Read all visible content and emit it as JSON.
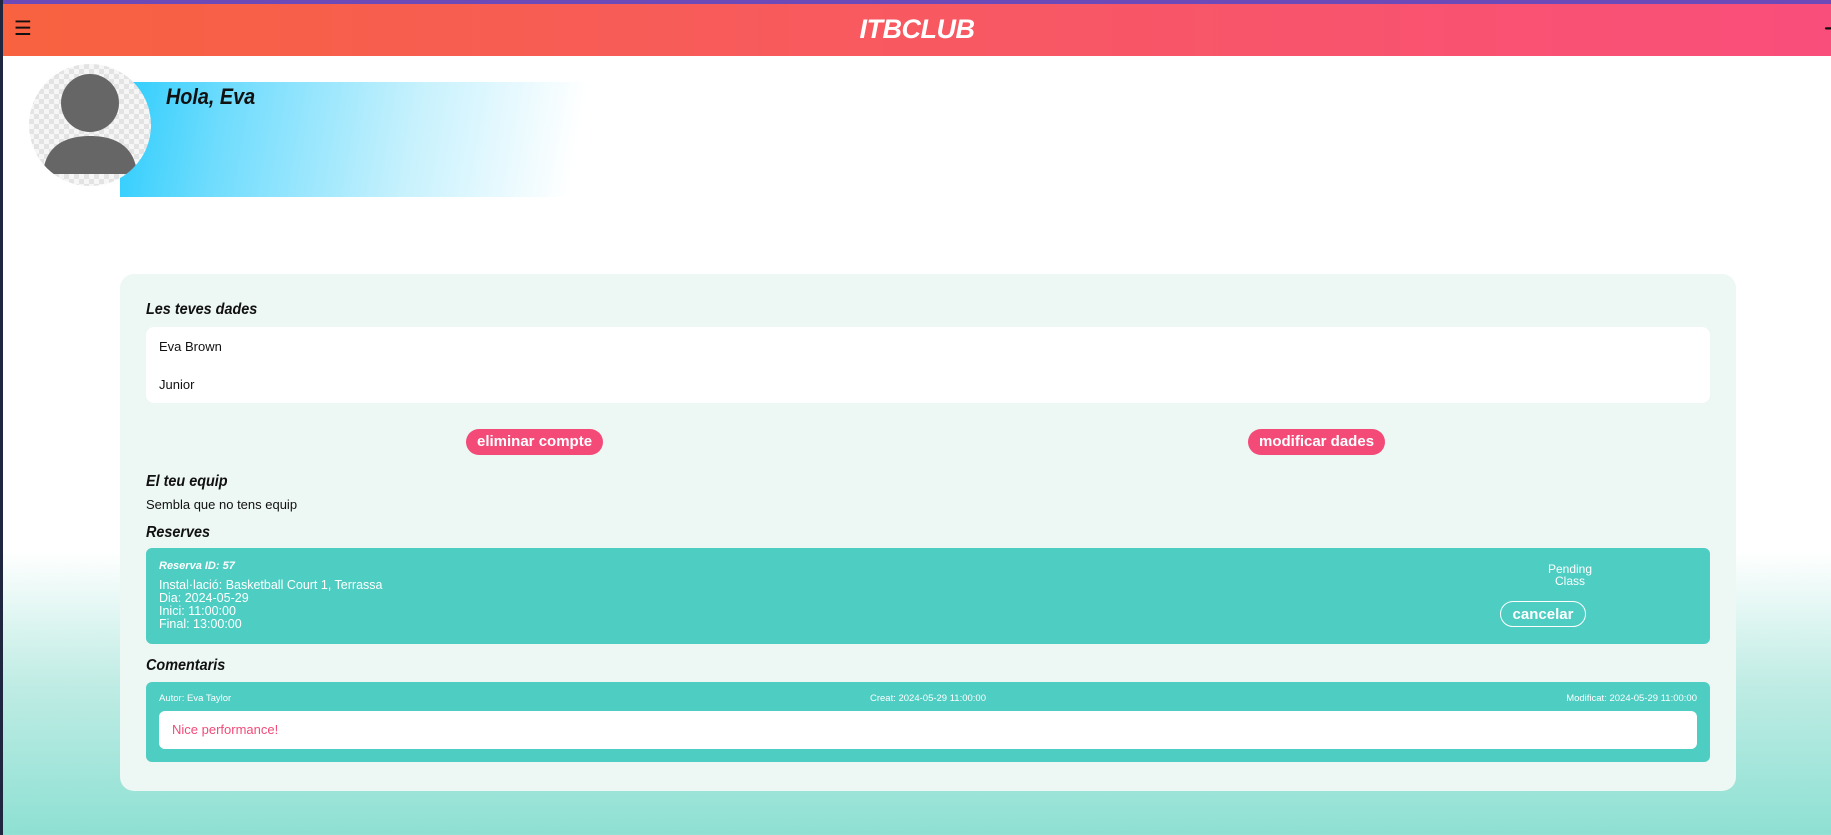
{
  "header": {
    "logo": "ITBCLUB",
    "menu_icon": "hamburger-menu-icon",
    "logout_icon": "logout-arrow-icon"
  },
  "profile": {
    "greeting": "Hola, Eva",
    "avatar_icon": "user-avatar-icon"
  },
  "your_data": {
    "title": "Les teves dades",
    "name": "Eva Brown",
    "category": "Junior"
  },
  "actions": {
    "delete_account": "eliminar compte",
    "modify_data": "modificar dades"
  },
  "team": {
    "title": "El teu equip",
    "empty_text": "Sembla que no tens equip"
  },
  "reservations": {
    "title": "Reserves",
    "items": [
      {
        "id_label": "Reserva ID: 57",
        "facility": "Instal·lació: Basketball Court 1, Terrassa",
        "day": "Dia: 2024-05-29",
        "start": "Inici: 11:00:00",
        "end": "Final: 13:00:00",
        "status": "Pending",
        "type": "Class",
        "cancel_label": "cancelar"
      }
    ]
  },
  "comments": {
    "title": "Comentaris",
    "items": [
      {
        "author": "Autor: Eva Taylor",
        "created": "Creat: 2024-05-29 11:00:00",
        "modified": "Modificat: 2024-05-29 11:00:00",
        "text": "Nice performance!"
      }
    ]
  },
  "colors": {
    "accent_pink": "#f34a78",
    "teal": "#4ecdc2",
    "header_start": "#f8623f",
    "header_end": "#f94e7b"
  }
}
